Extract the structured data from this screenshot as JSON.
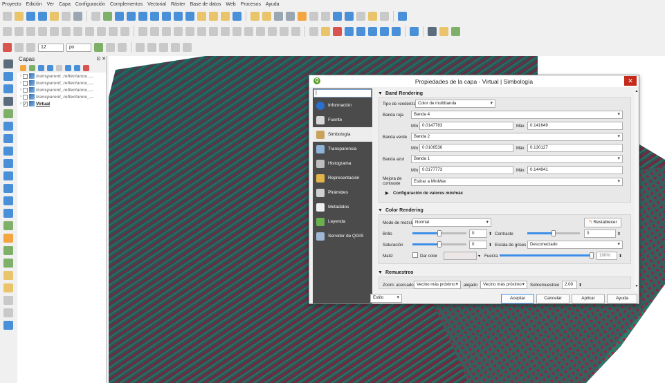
{
  "menubar": [
    "Proyecto",
    "Edición",
    "Ver",
    "Capa",
    "Configuración",
    "Complementos",
    "Vectorial",
    "Ráster",
    "Base de datos",
    "Web",
    "Procesos",
    "Ayuda"
  ],
  "toolbar": {
    "font_size": "12",
    "font_unit": "px"
  },
  "layers_panel": {
    "title": "Capas",
    "items": [
      {
        "label": "transparent_reflectance_...",
        "checked": false
      },
      {
        "label": "transparent_reflectance_...",
        "checked": false
      },
      {
        "label": "transparent_reflectance_...",
        "checked": false
      },
      {
        "label": "transparent_reflectance_...",
        "checked": false
      },
      {
        "label": "Virtual",
        "checked": true
      }
    ]
  },
  "dialog": {
    "title": "Propiedades de la capa - Virtual | Simbología",
    "close": "✕",
    "search_value": "|",
    "nav": [
      {
        "label": "Información",
        "icon": "info-icon",
        "color": "#2a6fd1"
      },
      {
        "label": "Fuente",
        "icon": "source-icon",
        "color": "#d9d9d9"
      },
      {
        "label": "Simbología",
        "icon": "symbology-icon",
        "color": "#c9a25b"
      },
      {
        "label": "Transparencia",
        "icon": "transparency-icon",
        "color": "#8fb3d9"
      },
      {
        "label": "Histograma",
        "icon": "histogram-icon",
        "color": "#bdbdbd"
      },
      {
        "label": "Representación",
        "icon": "rendering-icon",
        "color": "#e3b44b"
      },
      {
        "label": "Pirámides",
        "icon": "pyramids-icon",
        "color": "#d0d0d0"
      },
      {
        "label": "Metadatos",
        "icon": "metadata-icon",
        "color": "#f0f0f0"
      },
      {
        "label": "Leyenda",
        "icon": "legend-icon",
        "color": "#6ab04c"
      },
      {
        "label": "Servidor de QGIS",
        "icon": "server-icon",
        "color": "#9fb8d6"
      }
    ],
    "band": {
      "title": "Band Rendering",
      "renderer_label": "Tipo de renderizador",
      "renderer": "Color de multibanda",
      "min_label": "Mín",
      "max_label": "Máx",
      "red": {
        "label": "Banda roja",
        "band": "Banda 4",
        "min": "0.0147783",
        "max": "0.141649"
      },
      "green": {
        "label": "Banda verde",
        "band": "Banda 2",
        "min": "0.0106536",
        "max": "0.130127"
      },
      "blue": {
        "label": "Banda azul",
        "band": "Banda 1",
        "min": "0.0177773",
        "max": "0.144941"
      },
      "contrast_label1": "Mejora de",
      "contrast_label2": "contraste",
      "contrast": "Estirar a MinMax",
      "minmax_settings": "Configuración de valores mín/máx"
    },
    "color": {
      "title": "Color Rendering",
      "blend_label": "Modo de mezcla",
      "blend": "Normal",
      "reset": "Restablecer",
      "brightness_label": "Brillo",
      "brightness": "0",
      "contrast_label": "Contraste",
      "contrast": "0",
      "saturation_label": "Saturación",
      "saturation": "0",
      "grayscale_label": "Escala de grises",
      "grayscale": "Desconectado",
      "hue_label": "Matiz",
      "colorize_label": "Dar color",
      "strength_label": "Fuerza",
      "strength": "100%"
    },
    "resample": {
      "title": "Remuestreo",
      "zoomed_in_label": "Zoom: acercado",
      "zoomed_in": "Vecino más próximo",
      "zoomed_out_label": "alejado",
      "zoomed_out": "Vecino más próximo",
      "oversampling_label": "Sobremuestreo",
      "oversampling": "2.00"
    },
    "footer": {
      "style": "Estilo",
      "ok": "Aceptar",
      "cancel": "Cancelar",
      "apply": "Aplicar",
      "help": "Ayuda"
    }
  }
}
